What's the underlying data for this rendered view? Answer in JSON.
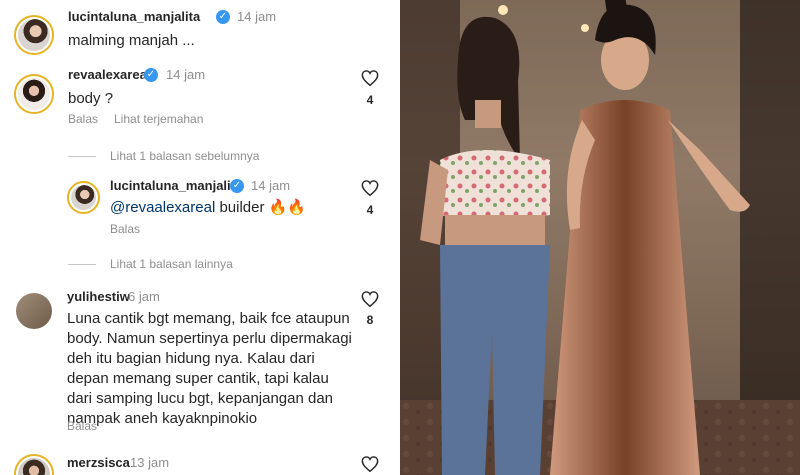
{
  "comments": [
    {
      "username": "lucintaluna_manjalita",
      "verified": true,
      "time": "14 jam",
      "text": "malming manjah ..."
    },
    {
      "username": "revaalexareal",
      "verified": true,
      "time": "14 jam",
      "text": "body ?",
      "likes": "4",
      "reply_label": "Balas",
      "translate_label": "Lihat terjemahan"
    },
    {
      "username": "yulihestiw",
      "time": "6 jam",
      "text": "Luna cantik bgt memang, baik fce ataupun body. Namun sepertinya perlu dipermakagi deh itu bagian hidung nya. Kalau dari depan memang super cantik, tapi kalau dari samping lucu bgt, kepanjangan dan nampak aneh kayaknpinokio",
      "likes": "8",
      "reply_label": "Balas"
    },
    {
      "username": "merzsisca",
      "time": "13 jam"
    }
  ],
  "view_prev": "Lihat 1 balasan sebelumnya",
  "reply": {
    "username": "lucintaluna_manjalita",
    "verified": true,
    "time": "14 jam",
    "mention": "@revaalexareal",
    "text": " builder 🔥🔥",
    "likes": "4",
    "reply_label": "Balas"
  },
  "view_more": "Lihat 1 balasan lainnya",
  "icons": {
    "verified": "verified-badge-icon",
    "like": "heart-icon"
  },
  "colors": {
    "verified": "#3897f0",
    "meta_text": "#8e8e8e",
    "mention": "#00376b",
    "story_ring": "#e6b325"
  }
}
